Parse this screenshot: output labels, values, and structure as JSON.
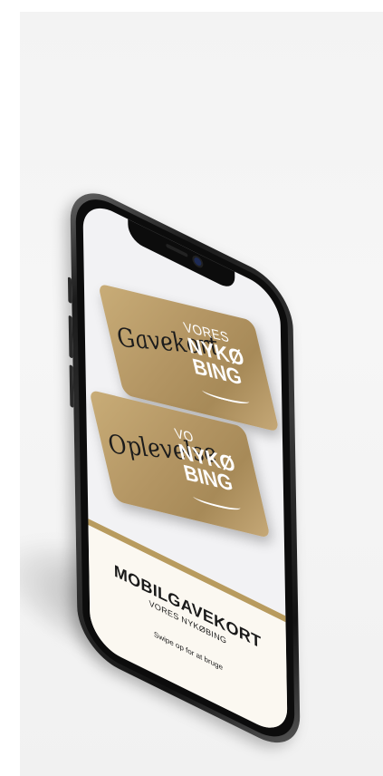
{
  "card_front": {
    "script_text": "Gavekort",
    "vores": "VORES",
    "line1": "NYKØ",
    "line2": "BING"
  },
  "card_back": {
    "script_text": "Oplevelse",
    "vores": "VO",
    "line1": "NYKØ",
    "line2": "BING"
  },
  "screen": {
    "title": "MOBILGAVEKORT",
    "subtitle": "VORES NYKØBING",
    "hint": "Swipe op for at bruge"
  },
  "colors": {
    "gold": "#b89b5e",
    "panel": "#fbf8f1",
    "card": "#b39563"
  },
  "icons": [
    "front-camera-icon",
    "speaker-grille-icon"
  ]
}
